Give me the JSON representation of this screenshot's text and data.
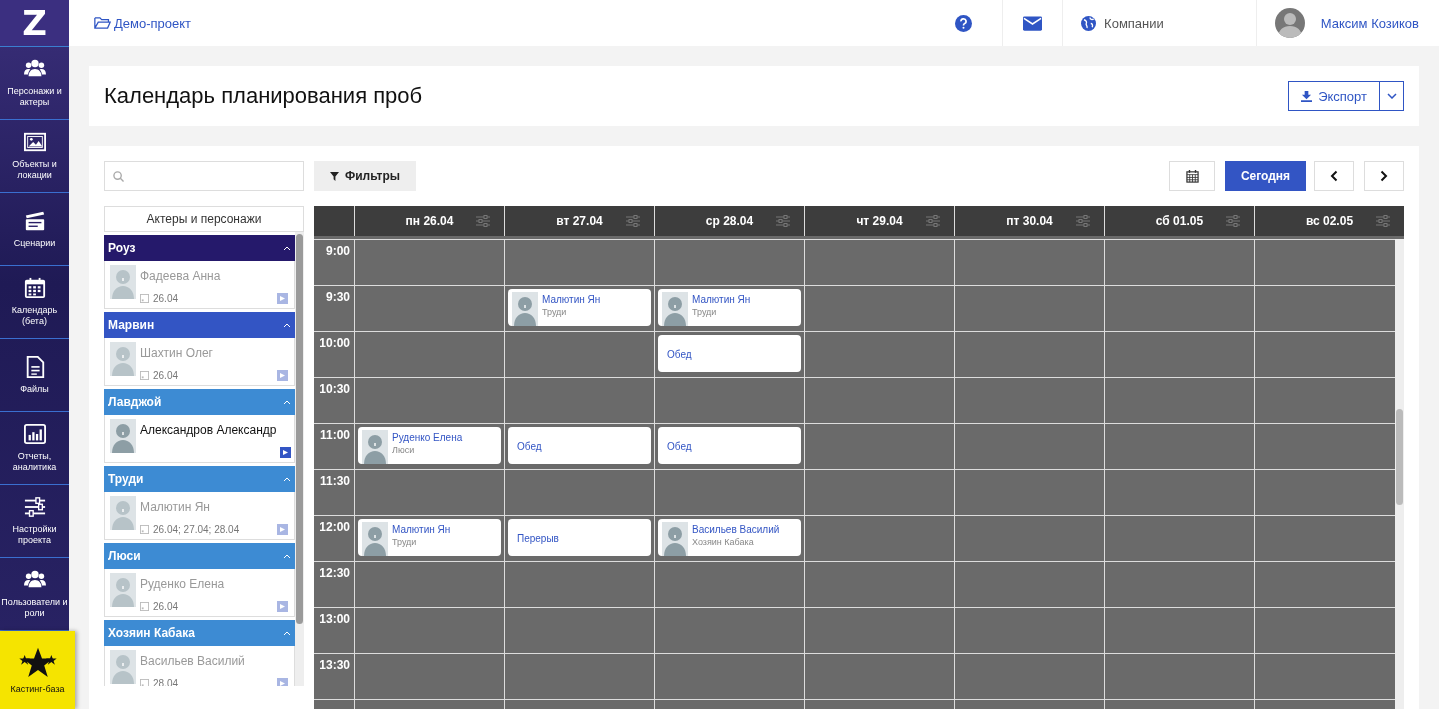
{
  "sidebar": {
    "logo": "Z",
    "items": [
      {
        "label": "Персонажи и актеры",
        "selected": false
      },
      {
        "label": "Объекты и локации",
        "selected": false
      },
      {
        "label": "Сценарии",
        "selected": false
      },
      {
        "label": "Календарь (бета)",
        "selected": false
      },
      {
        "label": "Файлы",
        "selected": false
      },
      {
        "label": "Отчеты, аналитика",
        "selected": false
      },
      {
        "label": "Настройки проекта",
        "selected": false
      },
      {
        "label": "Пользователи и роли",
        "selected": false
      },
      {
        "label": "Кастинг-база",
        "selected": true
      }
    ]
  },
  "topbar": {
    "project": "Демо-проект",
    "companies": "Компании",
    "user": "Максим Козиков"
  },
  "header": {
    "title": "Календарь планирования проб",
    "export": "Экспорт"
  },
  "toolbar": {
    "filters": "Фильтры",
    "today": "Сегодня"
  },
  "actors_panel": {
    "title": "Актеры и персонажи",
    "groups": [
      {
        "role": "Роуз",
        "color": "#25196b",
        "actor": "Фадеева Анна",
        "dates": "26.04",
        "active": false
      },
      {
        "role": "Марвин",
        "color": "#3355c4",
        "actor": "Шахтин Олег",
        "dates": "26.04",
        "active": false
      },
      {
        "role": "Лавджой",
        "color": "#3d8bd3",
        "actor": "Александров Александр",
        "active": true
      },
      {
        "role": "Труди",
        "color": "#3d8bd3",
        "actor": "Малютин Ян",
        "dates": "26.04; 27.04; 28.04",
        "active": false
      },
      {
        "role": "Люси",
        "color": "#3d8bd3",
        "actor": "Руденко Елена",
        "dates": "26.04",
        "active": false
      },
      {
        "role": "Хозяин Кабака",
        "color": "#3d8bd3",
        "actor": "Васильев Василий",
        "dates": "28.04",
        "active": false
      }
    ]
  },
  "calendar": {
    "days": [
      "пн 26.04",
      "вт 27.04",
      "ср 28.04",
      "чт 29.04",
      "пт 30.04",
      "сб 01.05",
      "вс 02.05"
    ],
    "rows": [
      {
        "time": "9:00",
        "cells": [
          {},
          {},
          {},
          {},
          {},
          {},
          {}
        ]
      },
      {
        "time": "9:30",
        "cells": [
          {},
          {
            "kind": "person",
            "name": "Малютин Ян",
            "role": "Труди"
          },
          {
            "kind": "person",
            "name": "Малютин Ян",
            "role": "Труди"
          },
          {},
          {},
          {},
          {}
        ]
      },
      {
        "time": "10:00",
        "cells": [
          {},
          {},
          {
            "kind": "note",
            "text": "Обед"
          },
          {},
          {},
          {},
          {}
        ]
      },
      {
        "time": "10:30",
        "cells": [
          {},
          {},
          {},
          {},
          {},
          {},
          {}
        ]
      },
      {
        "time": "11:00",
        "cells": [
          {
            "kind": "person",
            "name": "Руденко Елена",
            "role": "Люси"
          },
          {
            "kind": "note",
            "text": "Обед"
          },
          {
            "kind": "note",
            "text": "Обед"
          },
          {},
          {},
          {},
          {}
        ]
      },
      {
        "time": "11:30",
        "cells": [
          {},
          {},
          {},
          {},
          {},
          {},
          {}
        ]
      },
      {
        "time": "12:00",
        "cells": [
          {
            "kind": "person",
            "name": "Малютин Ян",
            "role": "Труди"
          },
          {
            "kind": "note",
            "text": "Перерыв"
          },
          {
            "kind": "person",
            "name": "Васильев Василий",
            "role": "Хозяин Кабака"
          },
          {},
          {},
          {},
          {}
        ]
      },
      {
        "time": "12:30",
        "cells": [
          {},
          {},
          {},
          {},
          {},
          {},
          {}
        ]
      },
      {
        "time": "13:00",
        "cells": [
          {},
          {},
          {},
          {},
          {},
          {},
          {}
        ]
      },
      {
        "time": "13:30",
        "cells": [
          {},
          {},
          {},
          {},
          {},
          {},
          {}
        ]
      }
    ]
  }
}
